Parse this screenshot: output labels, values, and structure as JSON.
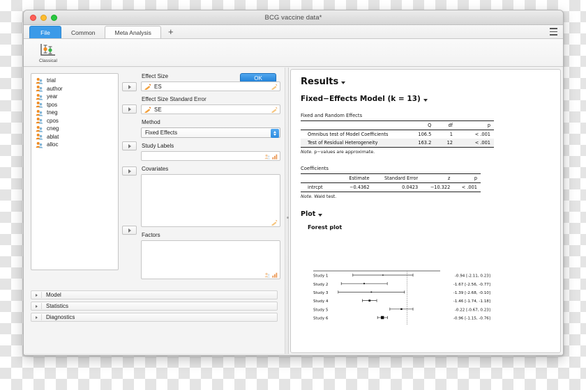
{
  "window": {
    "title": "BCG vaccine data*",
    "traffic_lights": [
      "close",
      "minimize",
      "zoom"
    ]
  },
  "tabs": [
    {
      "label": "File",
      "state": "file"
    },
    {
      "label": "Common",
      "state": "inactive"
    },
    {
      "label": "Meta Analysis",
      "state": "active"
    },
    {
      "label": "+",
      "state": "add"
    }
  ],
  "ribbon": {
    "items": [
      {
        "label": "Classical",
        "icon": "classical-meta-analysis-icon"
      }
    ],
    "menu_icon": "list-menu-icon"
  },
  "variables": [
    {
      "name": "trial",
      "icon": "nominal-icon"
    },
    {
      "name": "author",
      "icon": "nominal-icon"
    },
    {
      "name": "year",
      "icon": "nominal-icon"
    },
    {
      "name": "tpos",
      "icon": "nominal-icon"
    },
    {
      "name": "tneg",
      "icon": "nominal-icon"
    },
    {
      "name": "cpos",
      "icon": "nominal-icon"
    },
    {
      "name": "cneg",
      "icon": "nominal-icon"
    },
    {
      "name": "ablat",
      "icon": "nominal-icon"
    },
    {
      "name": "alloc",
      "icon": "nominal-icon"
    }
  ],
  "fields": {
    "effect_size": {
      "label": "Effect Size",
      "value": "ES",
      "icon": "scale-icon"
    },
    "effect_size_se": {
      "label": "Effect Size Standard Error",
      "value": "SE",
      "icon": "scale-icon"
    },
    "method": {
      "label": "Method",
      "value": "Fixed Effects"
    },
    "study_labels": {
      "label": "Study Labels",
      "value": ""
    },
    "covariates": {
      "label": "Covariates",
      "value": ""
    },
    "factors": {
      "label": "Factors",
      "value": ""
    },
    "ok_button": "OK"
  },
  "sections": [
    {
      "label": "Model"
    },
    {
      "label": "Statistics"
    },
    {
      "label": "Diagnostics"
    }
  ],
  "results": {
    "title": "Results",
    "model_heading": "Fixed−Effects Model (k = 13)",
    "effects_table": {
      "caption": "Fixed and Random Effects",
      "columns": [
        "",
        "Q",
        "df",
        "p"
      ],
      "rows": [
        {
          "label": "Omnibus test of Model Coefficients",
          "Q": "106.5",
          "df": "1",
          "p": "< .001"
        },
        {
          "label": "Test of Residual Heterogeneity",
          "Q": "163.2",
          "df": "12",
          "p": "< .001"
        }
      ],
      "note_prefix": "Note.",
      "note": " p−values are approximate."
    },
    "coefficients_table": {
      "caption": "Coefficients",
      "columns": [
        "",
        "Estimate",
        "Standard Error",
        "z",
        "p"
      ],
      "rows": [
        {
          "label": "intrcpt",
          "estimate": "−0.4362",
          "se": "0.0423",
          "z": "−10.322",
          "p": "< .001"
        }
      ],
      "note_prefix": "Note.",
      "note": " Wald test."
    },
    "plot": {
      "title": "Plot",
      "subtitle": "Forest plot"
    },
    "chart_data": {
      "type": "forest",
      "title": "Forest plot",
      "xlabel": "",
      "ylabel": "",
      "reference_line": 0,
      "xlim": [
        -3.0,
        0.8
      ],
      "studies": [
        {
          "label": "Study 1",
          "estimate": -0.94,
          "ci_low": -2.11,
          "ci_high": 0.23,
          "text": "-0.94 [-2.11,  0.23]",
          "weight": 0.9
        },
        {
          "label": "Study 2",
          "estimate": -1.67,
          "ci_low": -2.56,
          "ci_high": -0.77,
          "text": "-1.67 [-2.56, -0.77]",
          "weight": 1.1
        },
        {
          "label": "Study 3",
          "estimate": -1.39,
          "ci_low": -2.68,
          "ci_high": -0.1,
          "text": "-1.39 [-2.68, -0.10]",
          "weight": 1.0
        },
        {
          "label": "Study 4",
          "estimate": -1.46,
          "ci_low": -1.74,
          "ci_high": -1.18,
          "text": "-1.46 [-1.74, -1.18]",
          "weight": 1.6
        },
        {
          "label": "Study 5",
          "estimate": -0.22,
          "ci_low": -0.67,
          "ci_high": 0.23,
          "text": "-0.22 [-0.67,  0.23]",
          "weight": 1.4
        },
        {
          "label": "Study 6",
          "estimate": -0.96,
          "ci_low": -1.15,
          "ci_high": -0.76,
          "text": "-0.96 [-1.15, -0.76]",
          "weight": 2.6
        }
      ]
    }
  },
  "colors": {
    "accent": "#2e8ce0",
    "file_tab": "#3b9ae8",
    "window_bg": "#f0f0f0",
    "results_bg": "#ffffff",
    "nominal_icon_orange": "#ef8b22",
    "nominal_icon_blue": "#7fb3d5"
  }
}
